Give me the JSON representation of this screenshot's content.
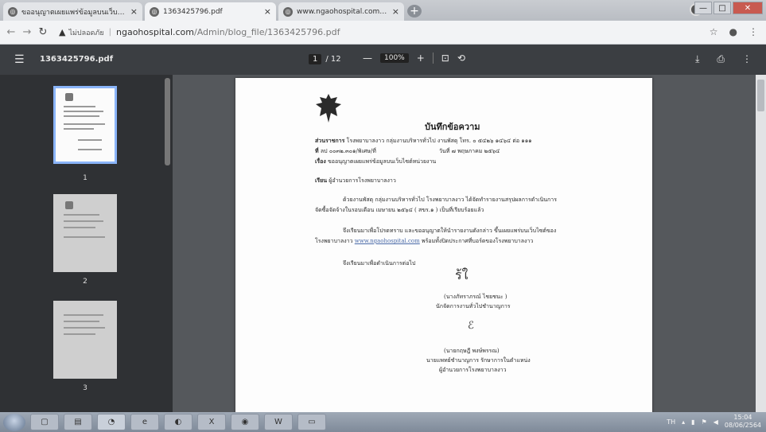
{
  "tabs": [
    {
      "title": "ขออนุญาตเผยแพร่ข้อมูลบนเว็บไซต์หน่วยงาน",
      "close": "×"
    },
    {
      "title": "1363425796.pdf",
      "close": "×"
    },
    {
      "title": "www.ngaohospital.com/Admin/",
      "close": "×"
    }
  ],
  "new_tab": "+",
  "window_controls": {
    "minimize": "—",
    "maximize": "□",
    "close": "✕"
  },
  "address_bar": {
    "security_warning": "ไม่ปลอดภัย",
    "url_host": "ngaohospital.com",
    "url_path": "/Admin/blog_file/1363425796.pdf"
  },
  "pdf_toolbar": {
    "filename": "1363425796.pdf",
    "current_page": "1",
    "total_pages": "/ 12",
    "zoom": "100%",
    "zoom_out": "—",
    "zoom_in": "+"
  },
  "thumbnails": [
    {
      "number": "1"
    },
    {
      "number": "2"
    },
    {
      "number": "3"
    }
  ],
  "document": {
    "title": "บันทึกข้อความ",
    "agency_label": "ส่วนราชการ",
    "agency_value": "โรงพยาบาลงาว  กลุ่มงานบริหารทั่วไป  งานพัสดุ     โทร. ๐ ๕๔๒๖ ๑๔๖๔ ต่อ ๑๑๑",
    "ref_label": "ที่",
    "ref_value": "ลป ๐๐๓๒.๓๐๑/พิเศษ/ที่",
    "date_label": "วันที่",
    "date_value": "๗   พฤษภาคม ๒๕๖๔",
    "subject_label": "เรื่อง",
    "subject_value": "ขออนุญาตเผยแพร่ข้อมูลบนเว็บไซต์หน่วยงาน",
    "to_label": "เรียน",
    "to_value": "ผู้อำนวยการโรงพยาบาลงาว",
    "para1_line1": "ด้วยงานพัสดุ กลุ่มงานบริหารทั่วไป  โรงพยาบาลงาว  ได้จัดทำรายงานสรุปผลการดำเนินการ",
    "para1_line2": "จัดซื้อจัดจ้างในรอบเดือน  เมษายน  ๒๕๖๔ ( สขร.๑ ) เป็นที่เรียบร้อยแล้ว",
    "para2_line1": "จึงเรียนมาเพื่อโปรดทราบ  และขออนุญาตให้นำรายงานดังกล่าว  ขึ้นเผยแพร่บนเว็บไซต์ของ",
    "para2_prefix": "โรงพยาบาลงาว",
    "para2_link": "www.ngaohospital.com",
    "para2_suffix": "พร้อมทั้งปิดประกาศที่บอร์ดของโรงพยาบาลงาว",
    "closing": "จึงเรียนมาเพื่อดำเนินการต่อไป",
    "signer1_name": "(นางภัทราภรณ์  ไชยชนะ )",
    "signer1_position": "นักจัดการงานทั่วไปชำนาญการ",
    "signer2_name": "(นายกฤษฎี   พงษ์พรรณ)",
    "signer2_position1": "นายแพทย์ชำนาญการ  รักษาการในตำแหน่ง",
    "signer2_position2": "ผู้อำนวยการโรงพยาบาลงาว"
  },
  "taskbar": {
    "apps": [
      {
        "label": "▢",
        "icon": "media-player-icon"
      },
      {
        "label": "▤",
        "icon": "file-explorer-icon"
      },
      {
        "label": "◔",
        "icon": "chrome-icon"
      },
      {
        "label": "e",
        "icon": "internet-explorer-icon"
      },
      {
        "label": "◐",
        "icon": "app-icon"
      },
      {
        "label": "X",
        "icon": "excel-icon"
      },
      {
        "label": "◉",
        "icon": "line-icon"
      },
      {
        "label": "W",
        "icon": "word-icon"
      },
      {
        "label": "▭",
        "icon": "window-icon"
      }
    ],
    "language": "TH",
    "time": "15:04",
    "date": "08/06/2564"
  },
  "colors": {
    "accent": "#8ab4f8",
    "pdf_toolbar_bg": "#3b3e42",
    "viewer_bg": "#55585c"
  }
}
